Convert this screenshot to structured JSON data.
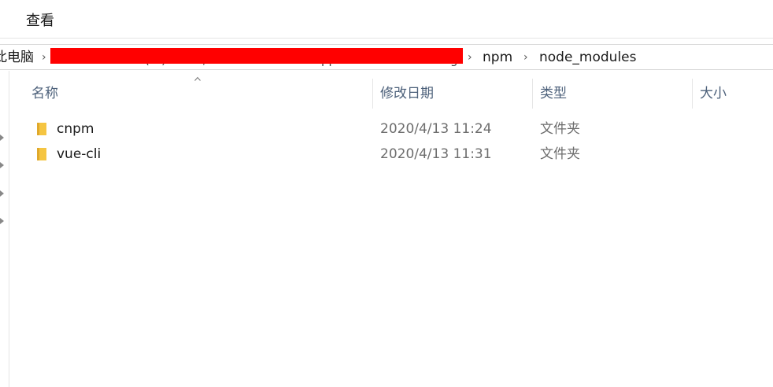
{
  "ribbon": {
    "tabs": [
      {
        "label": "查看"
      }
    ]
  },
  "address_bar": {
    "crumbs": [
      {
        "label": "此电脑"
      },
      {
        "label": "npm"
      },
      {
        "label": "node_modules"
      }
    ],
    "redacted_fragments": [
      "(",
      ")",
      "/",
      "pp",
      "g"
    ]
  },
  "columns": {
    "name": "名称",
    "date_modified": "修改日期",
    "type": "类型",
    "size": "大小"
  },
  "rows": [
    {
      "name": "cnpm",
      "date_modified": "2020/4/13 11:24",
      "type": "文件夹",
      "size": ""
    },
    {
      "name": "vue-cli",
      "date_modified": "2020/4/13 11:31",
      "type": "文件夹",
      "size": ""
    }
  ],
  "colors": {
    "redaction": "#ff0000",
    "header_text": "#4c607a",
    "folder": "#f5c542",
    "folder_dark": "#e0a92c"
  },
  "icons": {
    "folder": "folder-icon",
    "breadcrumb_separator": "chevron-right-icon",
    "sort_indicator": "chevron-up-icon",
    "nav_expand": "chevron-right-icon"
  }
}
